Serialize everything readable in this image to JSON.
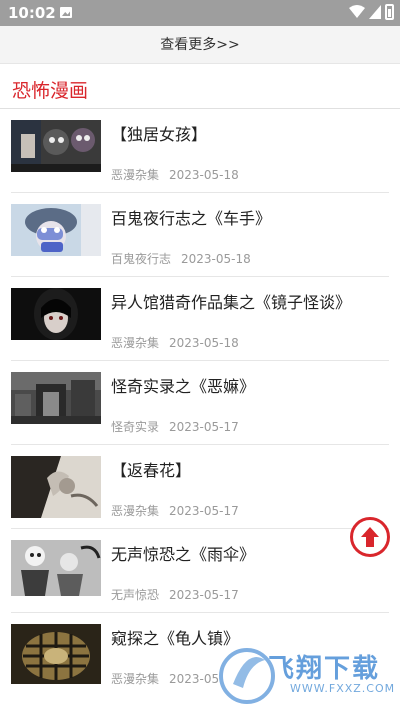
{
  "status_bar": {
    "time": "10:02"
  },
  "see_more": "查看更多>>",
  "section_title": "恐怖漫画",
  "items": [
    {
      "title": "【独居女孩】",
      "category": "恶漫杂集",
      "date": "2023-05-18"
    },
    {
      "title": "百鬼夜行志之《车手》",
      "category": "百鬼夜行志",
      "date": "2023-05-18"
    },
    {
      "title": "异人馆猎奇作品集之《镜子怪谈》",
      "category": "恶漫杂集",
      "date": "2023-05-18"
    },
    {
      "title": "怪奇实录之《恶嫲》",
      "category": "怪奇实录",
      "date": "2023-05-17"
    },
    {
      "title": "【返春花】",
      "category": "恶漫杂集",
      "date": "2023-05-17"
    },
    {
      "title": "无声惊恐之《雨伞》",
      "category": "无声惊恐",
      "date": "2023-05-17"
    },
    {
      "title": "窥探之《龟人镇》",
      "category": "恶漫杂集",
      "date": "2023-05"
    }
  ],
  "watermark": {
    "text": "飞翔下载",
    "url": "WWW.FXXZ.COM"
  },
  "colors": {
    "accent": "#d9262c",
    "status_bar": "#9e9e9e",
    "meta_text": "#9a9a9a"
  },
  "icons": {
    "scroll_top": "arrow-up-circle-icon",
    "wifi": "wifi-icon",
    "signal": "signal-icon",
    "battery": "battery-icon",
    "image": "image-notification-icon"
  }
}
